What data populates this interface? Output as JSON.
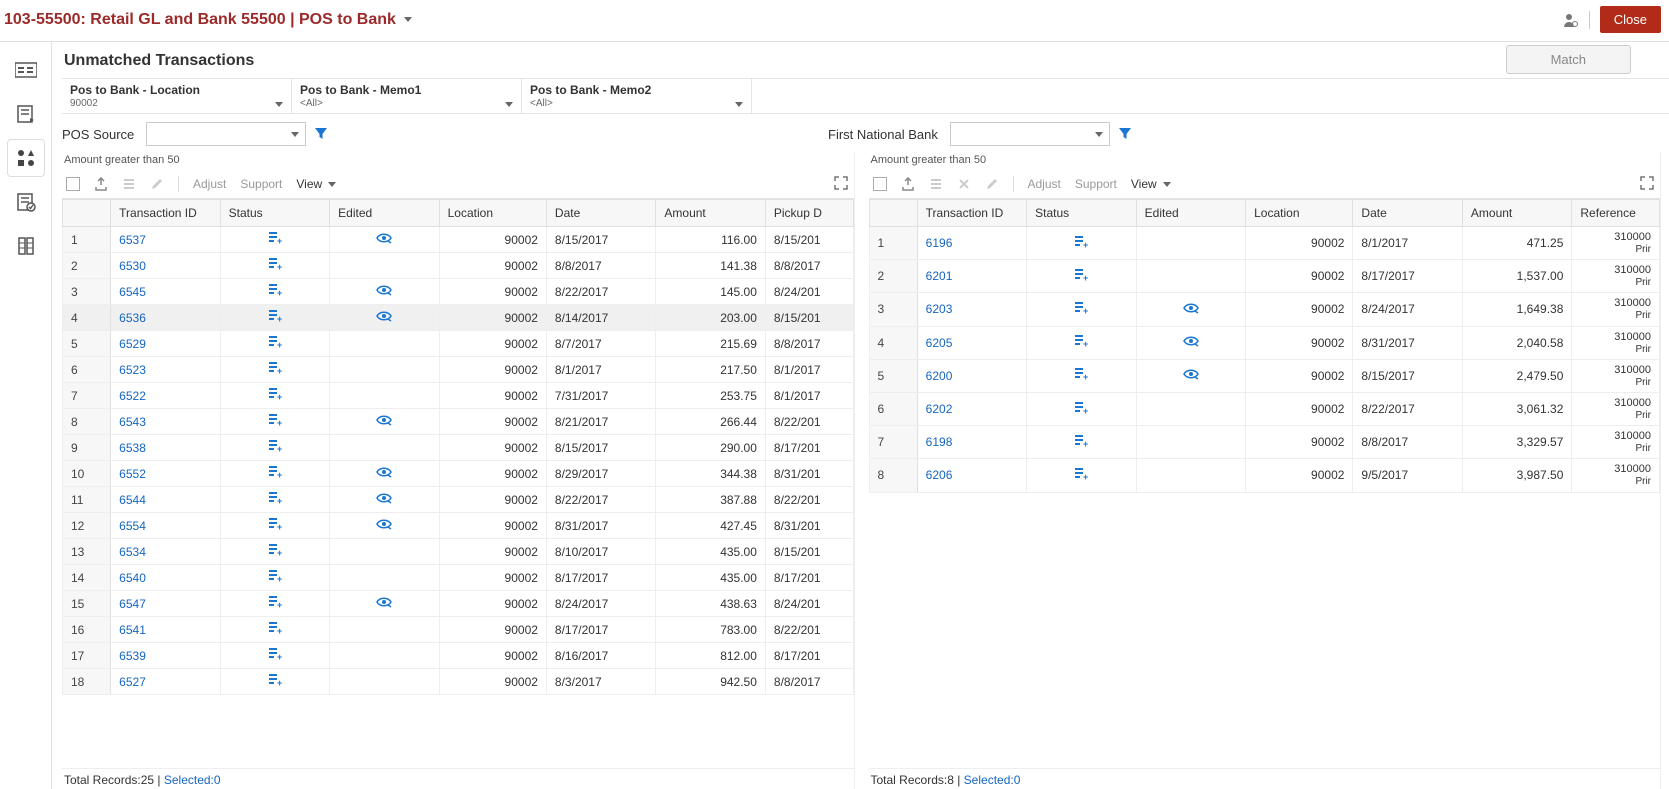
{
  "topbar": {
    "title": "103-55500: Retail GL and Bank 55500 | POS to Bank",
    "close": "Close"
  },
  "page": {
    "title": "Unmatched Transactions",
    "match": "Match"
  },
  "filters": [
    {
      "label": "Pos to Bank - Location",
      "value": "90002"
    },
    {
      "label": "Pos to Bank - Memo1",
      "value": "<All>"
    },
    {
      "label": "Pos to Bank - Memo2",
      "value": "<All>"
    }
  ],
  "left": {
    "sourceLabel": "POS Source",
    "sub": "Amount greater than 50",
    "toolbar": {
      "adjust": "Adjust",
      "support": "Support",
      "view": "View"
    },
    "columns": [
      "",
      "Transaction ID",
      "Status",
      "Edited",
      "Location",
      "Date",
      "Amount",
      "Pickup D"
    ],
    "rows": [
      {
        "n": "1",
        "tid": "6537",
        "edited": true,
        "loc": "90002",
        "date": "8/15/2017",
        "amt": "116.00",
        "pickup": "8/15/201"
      },
      {
        "n": "2",
        "tid": "6530",
        "edited": false,
        "loc": "90002",
        "date": "8/8/2017",
        "amt": "141.38",
        "pickup": "8/8/2017"
      },
      {
        "n": "3",
        "tid": "6545",
        "edited": true,
        "loc": "90002",
        "date": "8/22/2017",
        "amt": "145.00",
        "pickup": "8/24/201"
      },
      {
        "n": "4",
        "tid": "6536",
        "edited": true,
        "loc": "90002",
        "date": "8/14/2017",
        "amt": "203.00",
        "pickup": "8/15/201",
        "hl": true
      },
      {
        "n": "5",
        "tid": "6529",
        "edited": false,
        "loc": "90002",
        "date": "8/7/2017",
        "amt": "215.69",
        "pickup": "8/8/2017"
      },
      {
        "n": "6",
        "tid": "6523",
        "edited": false,
        "loc": "90002",
        "date": "8/1/2017",
        "amt": "217.50",
        "pickup": "8/1/2017"
      },
      {
        "n": "7",
        "tid": "6522",
        "edited": false,
        "loc": "90002",
        "date": "7/31/2017",
        "amt": "253.75",
        "pickup": "8/1/2017"
      },
      {
        "n": "8",
        "tid": "6543",
        "edited": true,
        "loc": "90002",
        "date": "8/21/2017",
        "amt": "266.44",
        "pickup": "8/22/201"
      },
      {
        "n": "9",
        "tid": "6538",
        "edited": false,
        "loc": "90002",
        "date": "8/15/2017",
        "amt": "290.00",
        "pickup": "8/17/201"
      },
      {
        "n": "10",
        "tid": "6552",
        "edited": true,
        "loc": "90002",
        "date": "8/29/2017",
        "amt": "344.38",
        "pickup": "8/31/201"
      },
      {
        "n": "11",
        "tid": "6544",
        "edited": true,
        "loc": "90002",
        "date": "8/22/2017",
        "amt": "387.88",
        "pickup": "8/22/201"
      },
      {
        "n": "12",
        "tid": "6554",
        "edited": true,
        "loc": "90002",
        "date": "8/31/2017",
        "amt": "427.45",
        "pickup": "8/31/201"
      },
      {
        "n": "13",
        "tid": "6534",
        "edited": false,
        "loc": "90002",
        "date": "8/10/2017",
        "amt": "435.00",
        "pickup": "8/15/201"
      },
      {
        "n": "14",
        "tid": "6540",
        "edited": false,
        "loc": "90002",
        "date": "8/17/2017",
        "amt": "435.00",
        "pickup": "8/17/201"
      },
      {
        "n": "15",
        "tid": "6547",
        "edited": true,
        "loc": "90002",
        "date": "8/24/2017",
        "amt": "438.63",
        "pickup": "8/24/201"
      },
      {
        "n": "16",
        "tid": "6541",
        "edited": false,
        "loc": "90002",
        "date": "8/17/2017",
        "amt": "783.00",
        "pickup": "8/22/201"
      },
      {
        "n": "17",
        "tid": "6539",
        "edited": false,
        "loc": "90002",
        "date": "8/16/2017",
        "amt": "812.00",
        "pickup": "8/17/201"
      },
      {
        "n": "18",
        "tid": "6527",
        "edited": false,
        "loc": "90002",
        "date": "8/3/2017",
        "amt": "942.50",
        "pickup": "8/8/2017"
      }
    ],
    "footer": {
      "total": "Total Records:25",
      "sep": " | ",
      "selected": "Selected:0"
    }
  },
  "right": {
    "sourceLabel": "First National Bank",
    "sub": "Amount greater than 50",
    "toolbar": {
      "adjust": "Adjust",
      "support": "Support",
      "view": "View"
    },
    "columns": [
      "",
      "Transaction ID",
      "Status",
      "Edited",
      "Location",
      "Date",
      "Amount",
      "Reference"
    ],
    "rows": [
      {
        "n": "1",
        "tid": "6196",
        "edited": false,
        "loc": "90002",
        "date": "8/1/2017",
        "amt": "471.25",
        "ref": "310000",
        "ref2": "Prir"
      },
      {
        "n": "2",
        "tid": "6201",
        "edited": false,
        "loc": "90002",
        "date": "8/17/2017",
        "amt": "1,537.00",
        "ref": "310000",
        "ref2": "Prir"
      },
      {
        "n": "3",
        "tid": "6203",
        "edited": true,
        "loc": "90002",
        "date": "8/24/2017",
        "amt": "1,649.38",
        "ref": "310000",
        "ref2": "Prir"
      },
      {
        "n": "4",
        "tid": "6205",
        "edited": true,
        "loc": "90002",
        "date": "8/31/2017",
        "amt": "2,040.58",
        "ref": "310000",
        "ref2": "Prir"
      },
      {
        "n": "5",
        "tid": "6200",
        "edited": true,
        "loc": "90002",
        "date": "8/15/2017",
        "amt": "2,479.50",
        "ref": "310000",
        "ref2": "Prir"
      },
      {
        "n": "6",
        "tid": "6202",
        "edited": false,
        "loc": "90002",
        "date": "8/22/2017",
        "amt": "3,061.32",
        "ref": "310000",
        "ref2": "Prir"
      },
      {
        "n": "7",
        "tid": "6198",
        "edited": false,
        "loc": "90002",
        "date": "8/8/2017",
        "amt": "3,329.57",
        "ref": "310000",
        "ref2": "Prir"
      },
      {
        "n": "8",
        "tid": "6206",
        "edited": false,
        "loc": "90002",
        "date": "9/5/2017",
        "amt": "3,987.50",
        "ref": "310000",
        "ref2": "Prir"
      }
    ],
    "footer": {
      "total": "Total Records:8",
      "sep": " | ",
      "selected": "Selected:0"
    }
  }
}
